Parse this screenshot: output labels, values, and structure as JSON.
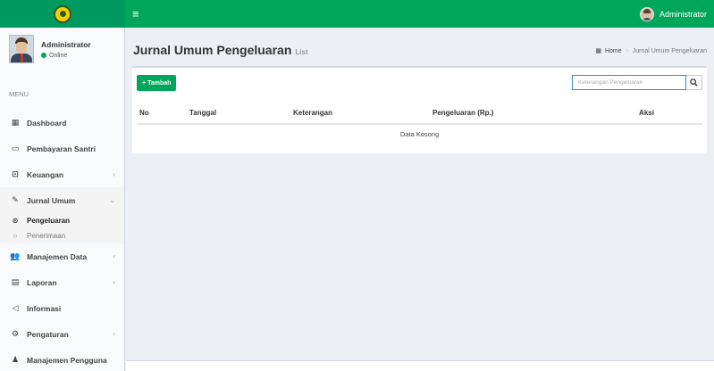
{
  "header": {
    "user_name": "Administrator"
  },
  "sidebar": {
    "user": {
      "name": "Administrator",
      "status": "Online"
    },
    "menu_header": "MENU",
    "items": [
      {
        "label": "Dashboard",
        "icon": "dashboard-icon"
      },
      {
        "label": "Pembayaran Santri",
        "icon": "credit-card-icon"
      },
      {
        "label": "Keuangan",
        "icon": "money-icon"
      },
      {
        "label": "Jurnal Umum",
        "icon": "edit-icon"
      },
      {
        "label": "Manajemen Data",
        "icon": "users-icon"
      },
      {
        "label": "Laporan",
        "icon": "file-icon"
      },
      {
        "label": "Informasi",
        "icon": "bullhorn-icon"
      },
      {
        "label": "Pengaturan",
        "icon": "gear-icon"
      },
      {
        "label": "Manajemen Pengguna",
        "icon": "user-icon"
      }
    ],
    "subitems": [
      {
        "label": "Pengeluaran"
      },
      {
        "label": "Penerimaan"
      }
    ]
  },
  "page": {
    "title": "Jurnal Umum Pengeluaran",
    "subtitle": "List"
  },
  "breadcrumb": {
    "home": "Home",
    "current": "Jurnal Umum Pengeluaran"
  },
  "toolbar": {
    "add_label": "Tambah",
    "search_placeholder": "Keterangan Pengeluaran"
  },
  "table": {
    "columns": [
      "No",
      "Tanggal",
      "Keterangan",
      "Pengeluaran (Rp.)",
      "Aksi"
    ],
    "empty_text": "Data Kosong"
  },
  "colors": {
    "brand": "#00a65a",
    "accent": "#3c8dbc"
  }
}
